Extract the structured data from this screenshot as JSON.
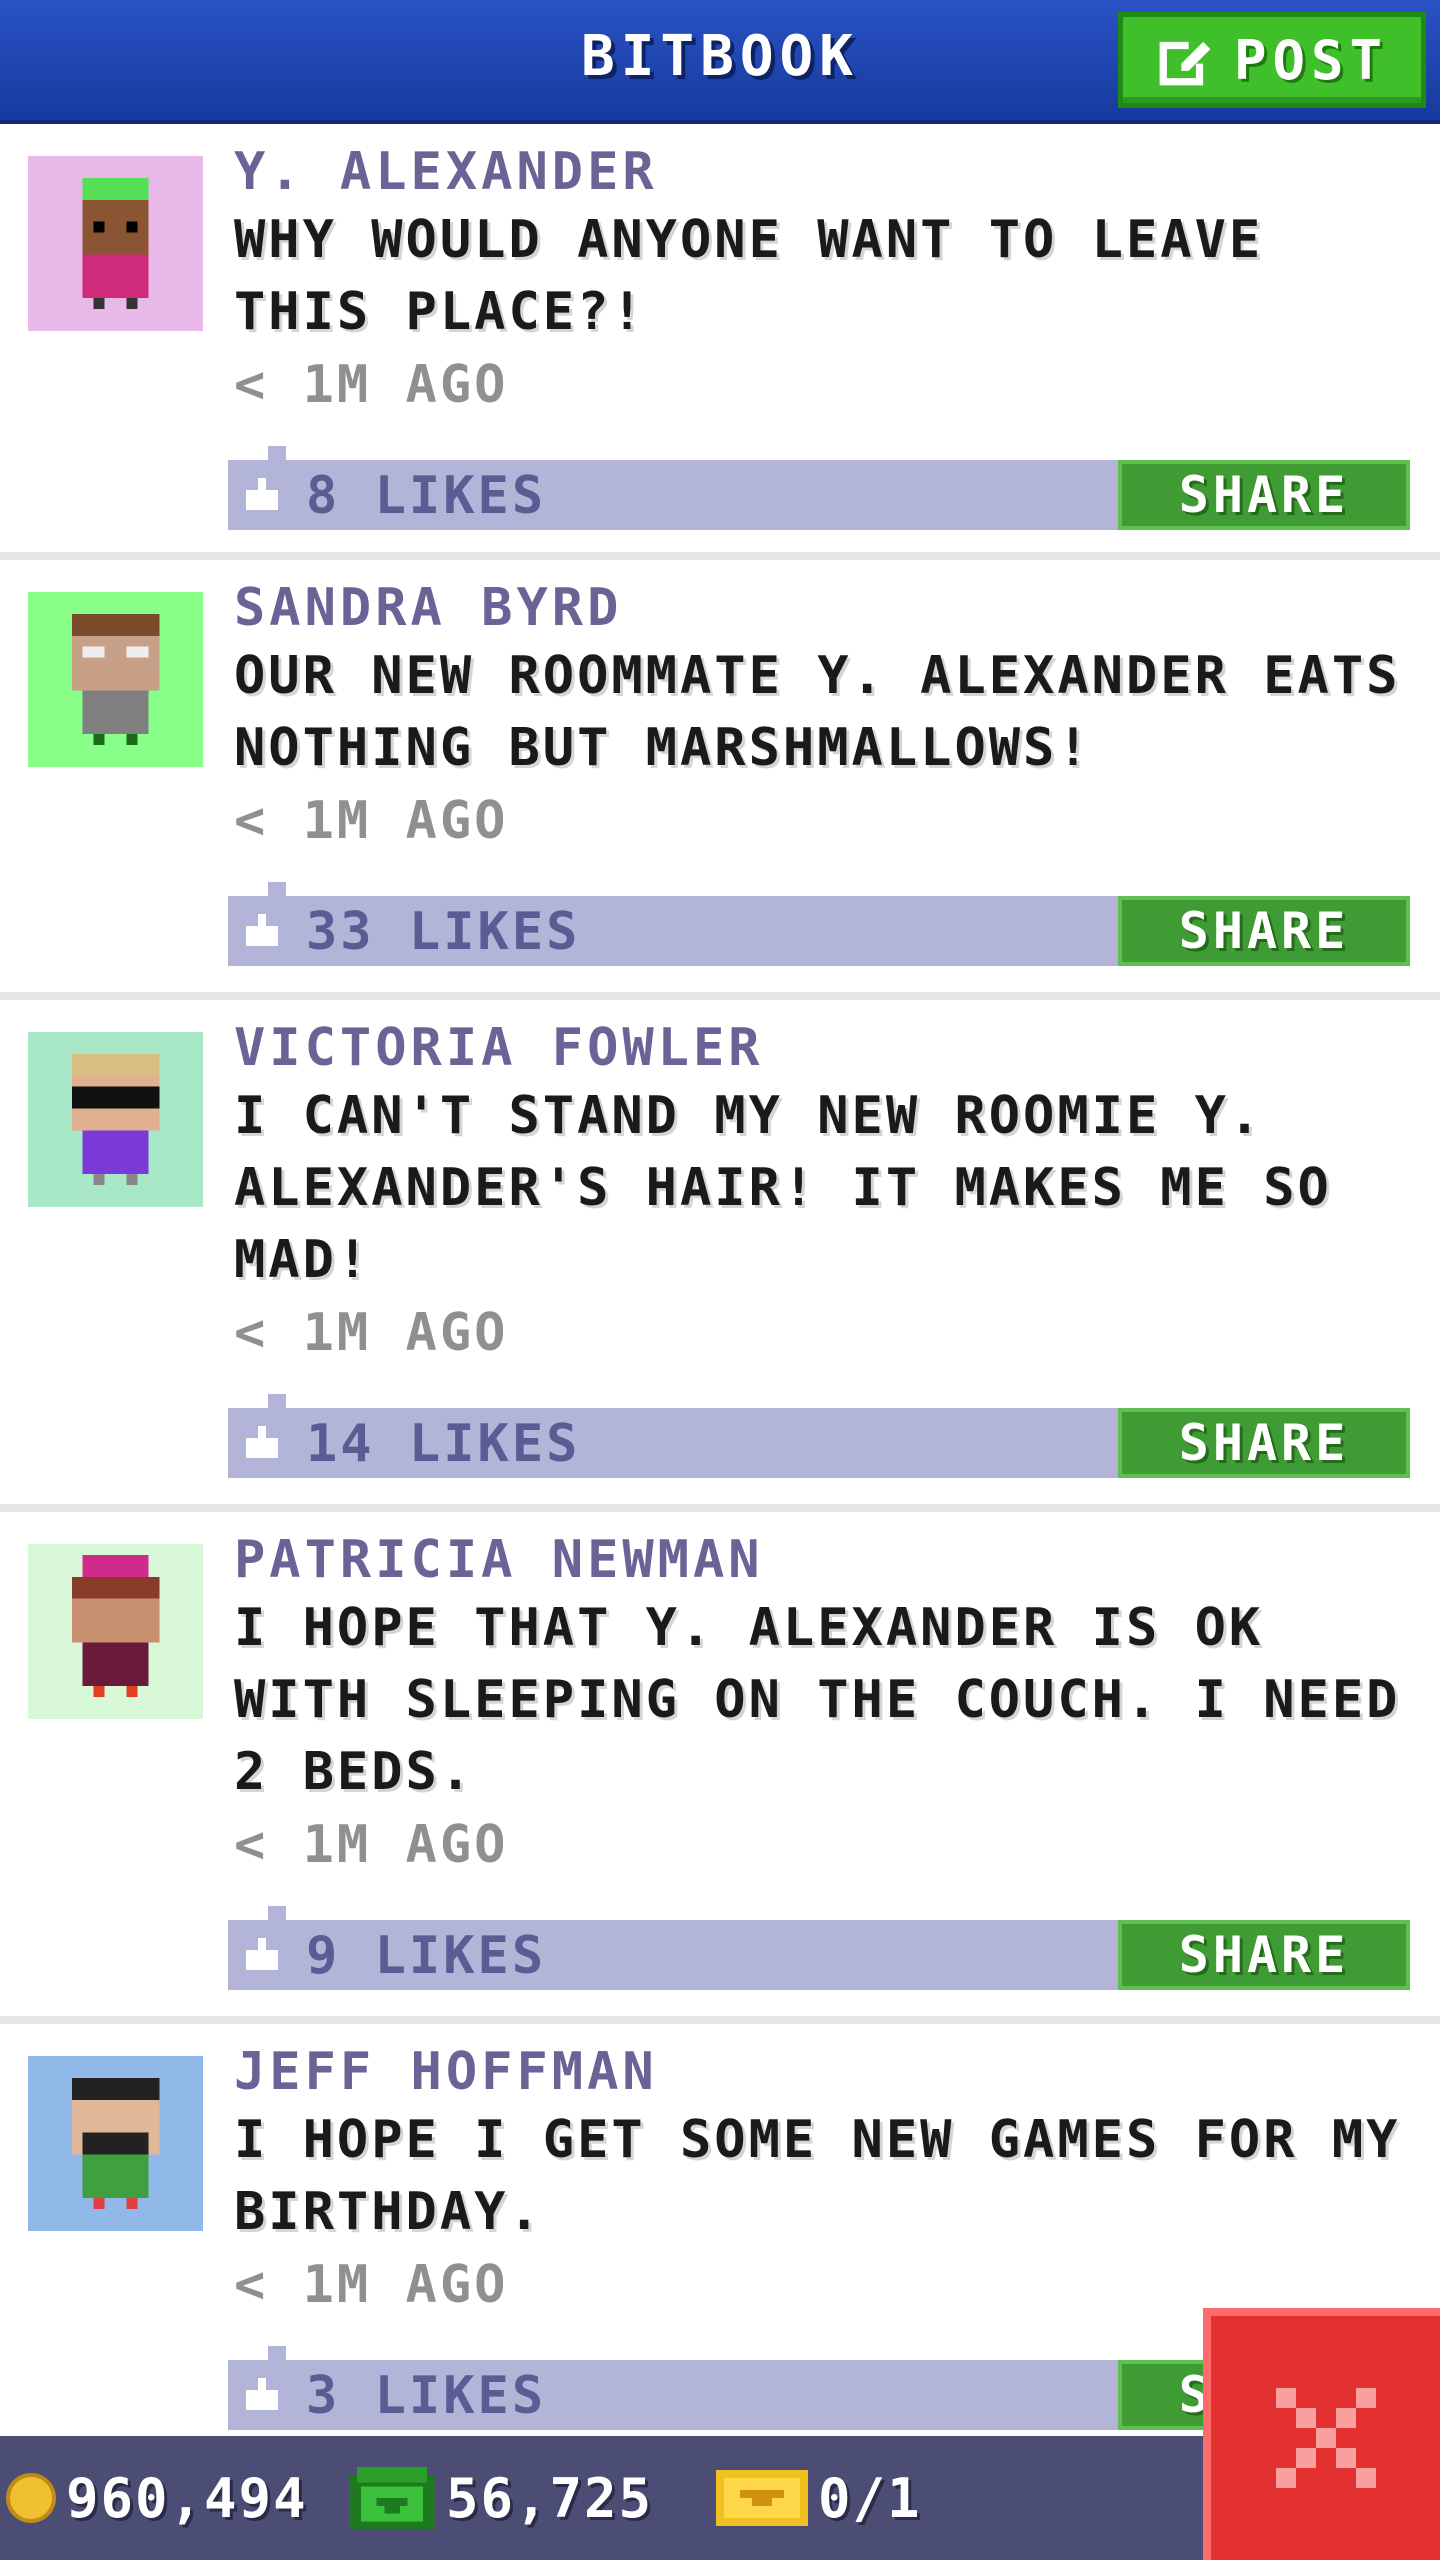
{
  "header": {
    "title": "BITBOOK",
    "post_label": "POST"
  },
  "posts": [
    {
      "author": "Y. ALEXANDER",
      "message": "WHY WOULD ANYONE WANT TO LEAVE THIS PLACE?!",
      "time": "< 1M AGO",
      "likes": "8 LIKES",
      "share": "SHARE",
      "avatar_bg": "#e8b8e8"
    },
    {
      "author": "SANDRA BYRD",
      "message": "OUR NEW ROOMMATE Y. ALEXANDER EATS NOTHING BUT MARSHMALLOWS!",
      "time": "< 1M AGO",
      "likes": "33 LIKES",
      "share": "SHARE",
      "avatar_bg": "#88ff88"
    },
    {
      "author": "VICTORIA FOWLER",
      "message": "I CAN'T STAND MY NEW ROOMIE Y. ALEXANDER'S HAIR! IT MAKES ME SO MAD!",
      "time": "< 1M AGO",
      "likes": "14 LIKES",
      "share": "SHARE",
      "avatar_bg": "#a8e8c8"
    },
    {
      "author": "PATRICIA NEWMAN",
      "message": "I HOPE THAT Y. ALEXANDER IS OK WITH SLEEPING ON THE COUCH. I NEED 2 BEDS.",
      "time": "< 1M AGO",
      "likes": "9 LIKES",
      "share": "SHARE",
      "avatar_bg": "#d8f8d8"
    },
    {
      "author": "JEFF HOFFMAN",
      "message": "I HOPE I GET SOME NEW GAMES FOR MY BIRTHDAY.",
      "time": "< 1M AGO",
      "likes": "3 LIKES",
      "share": "SHARE",
      "avatar_bg": "#90b8e8"
    }
  ],
  "bottom_bar": {
    "coins": "960,494",
    "bux": "56,725",
    "tickets": "0/1"
  },
  "colors": {
    "header": "#1e46b4",
    "post_button": "#3fbf2a",
    "share_button": "#3f9b33",
    "like_bar": "#b3b5d8",
    "close_button": "#e23030"
  }
}
